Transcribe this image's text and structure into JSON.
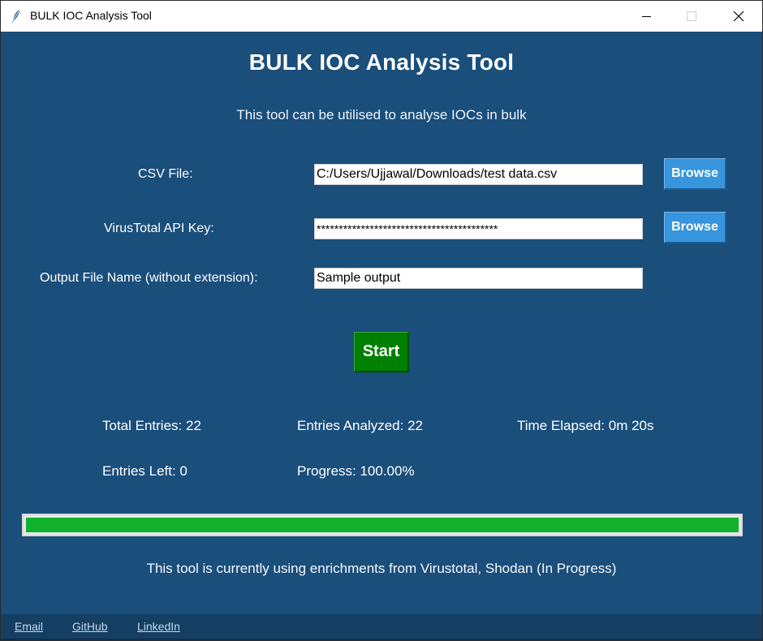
{
  "window": {
    "title": "BULK IOC Analysis Tool",
    "icon": "feather-icon",
    "controls": [
      "minimize-icon",
      "maximize-icon",
      "close-icon"
    ]
  },
  "header": {
    "title": "BULK IOC Analysis Tool",
    "subtitle": "This tool can be utilised to analyse IOCs in bulk"
  },
  "form": {
    "csv_label": "CSV File:",
    "csv_value": "C:/Users/Ujjawal/Downloads/test data.csv",
    "csv_browse_label": "Browse",
    "api_label": "VirusTotal API Key:",
    "api_value": "*****************************************",
    "api_browse_label": "Browse",
    "output_label": "Output File Name (without extension):",
    "output_value": "Sample output"
  },
  "actions": {
    "start_label": "Start"
  },
  "stats": {
    "total_entries": "Total Entries: 22",
    "entries_analyzed": "Entries Analyzed: 22",
    "time_elapsed": "Time Elapsed: 0m 20s",
    "entries_left": "Entries Left: 0",
    "progress": "Progress: 100.00%"
  },
  "progress": {
    "fraction": 1.0,
    "fill_color": "#12b12c"
  },
  "enrichment_note": "This tool is currently using enrichments from Virustotal, Shodan (In Progress)",
  "footer": {
    "links": [
      "Email",
      "GitHub",
      "LinkedIn"
    ]
  },
  "colors": {
    "background": "#1a4e7b",
    "browse_button": "#3795dd",
    "start_button": "#008000",
    "footer": "#143f63"
  }
}
